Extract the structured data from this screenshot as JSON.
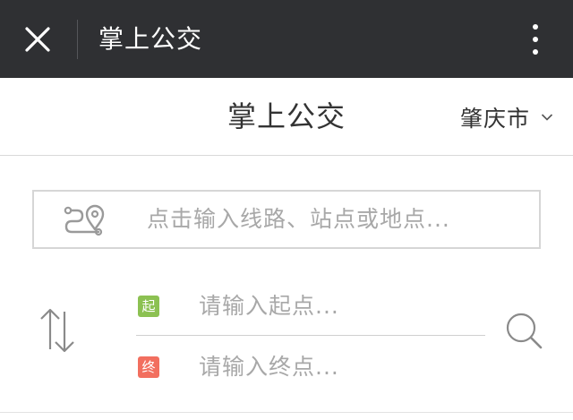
{
  "titlebar": {
    "title": "掌上公交",
    "close_icon": "close-icon",
    "more_icon": "more-vertical-icon",
    "background": "#2f3033"
  },
  "header": {
    "title": "掌上公交",
    "city": "肇庆市",
    "city_icon": "chevron-down-icon"
  },
  "search": {
    "placeholder": "点击输入线路、站点或地点...",
    "icon": "route-pin-icon"
  },
  "route": {
    "from_badge": "起",
    "from_placeholder": "请输入起点...",
    "to_badge": "终",
    "to_placeholder": "请输入终点...",
    "swap_icon": "swap-arrows-icon",
    "search_icon": "search-icon",
    "colors": {
      "from": "#8cc152",
      "to": "#f26f5f"
    }
  }
}
